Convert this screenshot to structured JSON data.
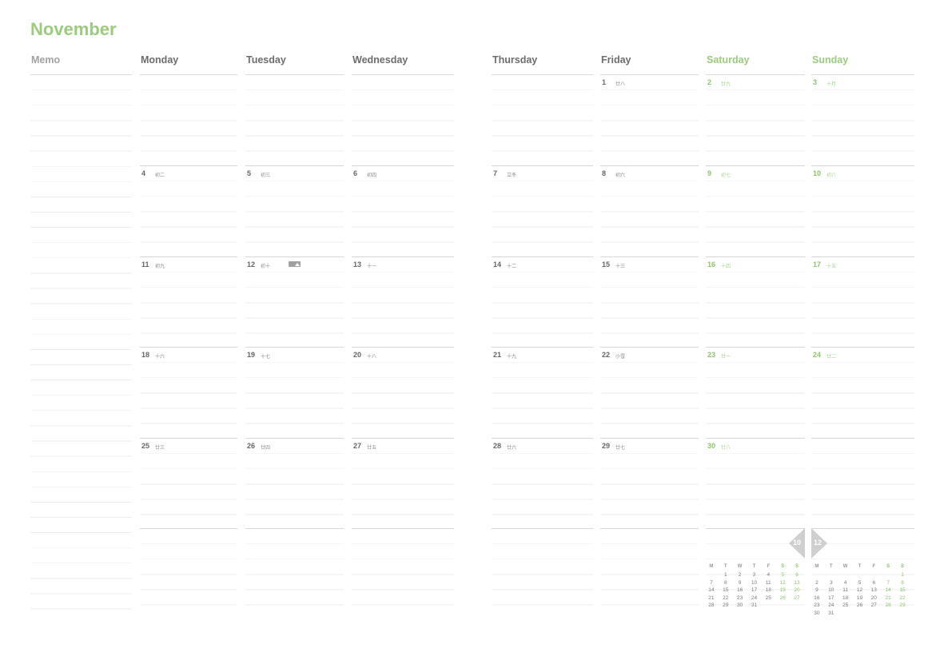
{
  "month_title": "November",
  "colors": {
    "accent": "#9ccb7f",
    "text": "#6d6d6d",
    "line": "#ececec"
  },
  "headers": {
    "memo": "Memo",
    "mon": "Monday",
    "tue": "Tuesday",
    "wed": "Wednesday",
    "thu": "Thursday",
    "fri": "Friday",
    "sat": "Saturday",
    "sun": "Sunday"
  },
  "weeks": [
    [
      null,
      null,
      null,
      null,
      {
        "day": "1",
        "lunar": "廿八"
      },
      {
        "day": "2",
        "lunar": "廿九"
      },
      {
        "day": "3",
        "lunar": "十月"
      }
    ],
    [
      {
        "day": "4",
        "lunar": "初二"
      },
      {
        "day": "5",
        "lunar": "初三"
      },
      {
        "day": "6",
        "lunar": "初四"
      },
      {
        "day": "7",
        "lunar": "立冬"
      },
      {
        "day": "8",
        "lunar": "初六"
      },
      {
        "day": "9",
        "lunar": "初七"
      },
      {
        "day": "10",
        "lunar": "初八"
      }
    ],
    [
      {
        "day": "11",
        "lunar": "初九"
      },
      {
        "day": "12",
        "lunar": "初十"
      },
      {
        "day": "13",
        "lunar": "十一"
      },
      {
        "day": "14",
        "lunar": "十二"
      },
      {
        "day": "15",
        "lunar": "十三"
      },
      {
        "day": "16",
        "lunar": "十四"
      },
      {
        "day": "17",
        "lunar": "十五"
      }
    ],
    [
      {
        "day": "18",
        "lunar": "十六"
      },
      {
        "day": "19",
        "lunar": "十七"
      },
      {
        "day": "20",
        "lunar": "十八"
      },
      {
        "day": "21",
        "lunar": "十九"
      },
      {
        "day": "22",
        "lunar": "小雪"
      },
      {
        "day": "23",
        "lunar": "廿一"
      },
      {
        "day": "24",
        "lunar": "廿二"
      }
    ],
    [
      {
        "day": "25",
        "lunar": "廿三"
      },
      {
        "day": "26",
        "lunar": "廿四"
      },
      {
        "day": "27",
        "lunar": "廿五"
      },
      {
        "day": "28",
        "lunar": "廿六"
      },
      {
        "day": "29",
        "lunar": "廿七"
      },
      {
        "day": "30",
        "lunar": "廿八"
      },
      null
    ],
    [
      null,
      null,
      null,
      null,
      null,
      null,
      null
    ]
  ],
  "photo_icon_cell": "12",
  "nav": {
    "prev_label": "10",
    "next_label": "12"
  },
  "mini_calendars": {
    "weekday_heads": [
      "M",
      "T",
      "W",
      "T",
      "F",
      "S",
      "S"
    ],
    "prev": {
      "rows": [
        [
          "",
          "1",
          "2",
          "3",
          "4",
          "5",
          "6"
        ],
        [
          "7",
          "8",
          "9",
          "10",
          "11",
          "12",
          "13"
        ],
        [
          "14",
          "15",
          "16",
          "17",
          "18",
          "19",
          "20"
        ],
        [
          "21",
          "22",
          "23",
          "24",
          "25",
          "26",
          "27"
        ],
        [
          "28",
          "29",
          "30",
          "31",
          "",
          "",
          ""
        ]
      ]
    },
    "next": {
      "rows": [
        [
          "",
          "",
          "",
          "",
          "",
          "",
          "1"
        ],
        [
          "2",
          "3",
          "4",
          "5",
          "6",
          "7",
          "8"
        ],
        [
          "9",
          "10",
          "11",
          "12",
          "13",
          "14",
          "15"
        ],
        [
          "16",
          "17",
          "18",
          "19",
          "20",
          "21",
          "22"
        ],
        [
          "23",
          "24",
          "25",
          "26",
          "27",
          "28",
          "29"
        ],
        [
          "30",
          "31",
          "",
          "",
          "",
          "",
          ""
        ]
      ]
    }
  }
}
